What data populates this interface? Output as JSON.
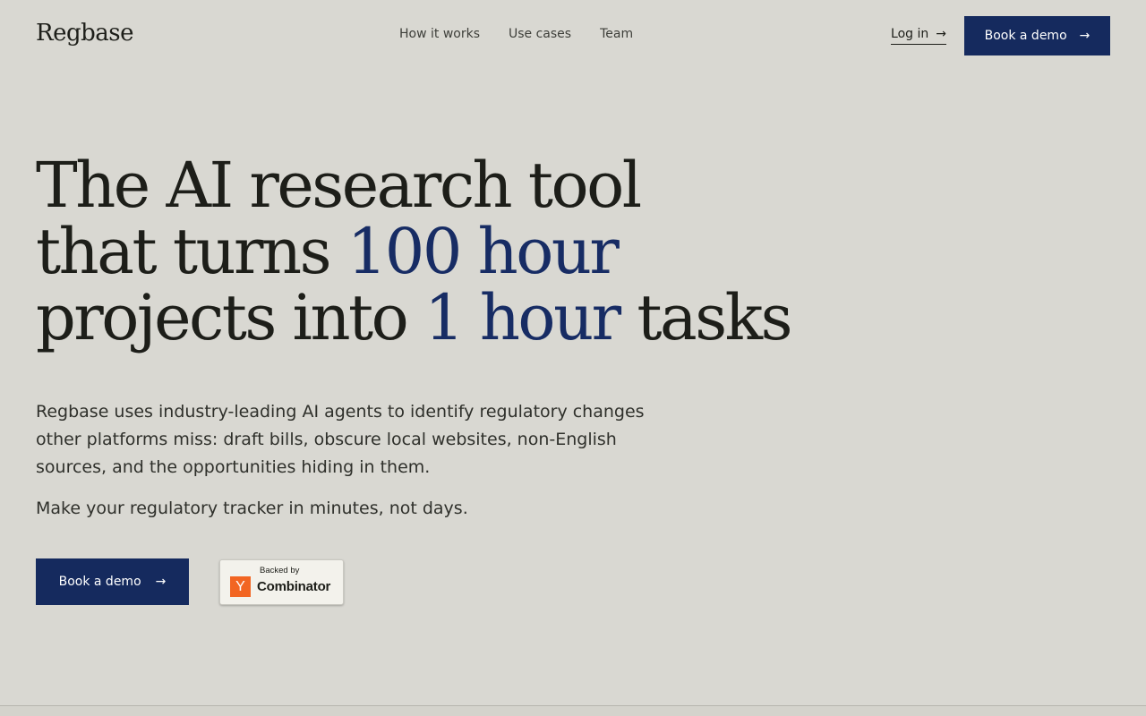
{
  "header": {
    "logo": "Regbase",
    "nav": [
      {
        "label": "How it works"
      },
      {
        "label": "Use cases"
      },
      {
        "label": "Team"
      }
    ],
    "login_label": "Log in",
    "login_arrow": "→",
    "demo_label": "Book a demo",
    "demo_arrow": "→"
  },
  "hero": {
    "title_line1": "The AI research tool",
    "title_line2_prefix": "that turns ",
    "title_line2_accent": "100 hour",
    "title_line3_prefix": "projects into ",
    "title_line3_accent": "1 hour",
    "title_line3_suffix": " tasks",
    "description": "Regbase uses industry-leading AI agents to identify regulatory changes other platforms miss: draft bills, obscure local websites, non-English sources, and the opportunities hiding in them.",
    "subline": "Make your regulatory tracker in minutes, not days.",
    "cta_label": "Book a demo",
    "cta_arrow": "→"
  },
  "badge": {
    "backed_by": "Backed by",
    "logo_letter": "Y",
    "name": "Combinator"
  },
  "colors": {
    "background": "#d9d8d2",
    "accent": "#152a5e",
    "text": "#1d1e19",
    "yc_orange": "#f26522"
  },
  "icons": {
    "login_arrow": "arrow-right-icon",
    "demo_arrow": "arrow-right-icon"
  }
}
